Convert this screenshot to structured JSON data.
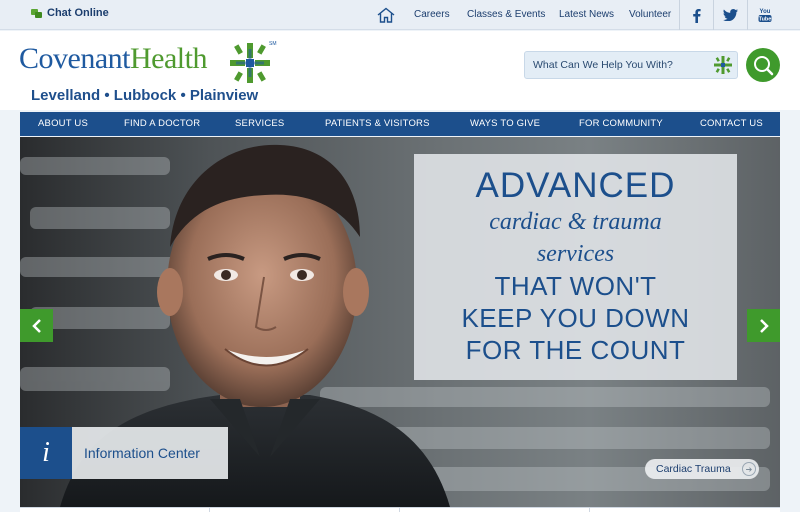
{
  "topbar": {
    "chat_label": "Chat Online",
    "links": [
      "Careers",
      "Classes & Events",
      "Latest News",
      "Volunteer"
    ],
    "social": [
      "f",
      "twitter",
      "YouTube"
    ]
  },
  "header": {
    "logo_part1": "Covenant",
    "logo_part2": "Health",
    "logo_sm": "SM",
    "cities": "Levelland • Lubbock • Plainview",
    "search_placeholder": "What Can We Help You With?"
  },
  "nav": [
    "ABOUT US",
    "FIND A DOCTOR",
    "SERVICES",
    "PATIENTS & VISITORS",
    "WAYS TO GIVE",
    "FOR COMMUNITY",
    "CONTACT US"
  ],
  "hero": {
    "line1": "ADVANCED",
    "line2": "cardiac & trauma",
    "line3": "services",
    "line4": "THAT WON'T",
    "line5": "KEEP YOU DOWN",
    "line6": "FOR THE COUNT",
    "info_label": "Information Center",
    "info_icon": "i",
    "tag_label": "Cardiac Trauma"
  },
  "colors": {
    "brand_blue": "#1c4f8c",
    "brand_green": "#3f9a2c"
  }
}
